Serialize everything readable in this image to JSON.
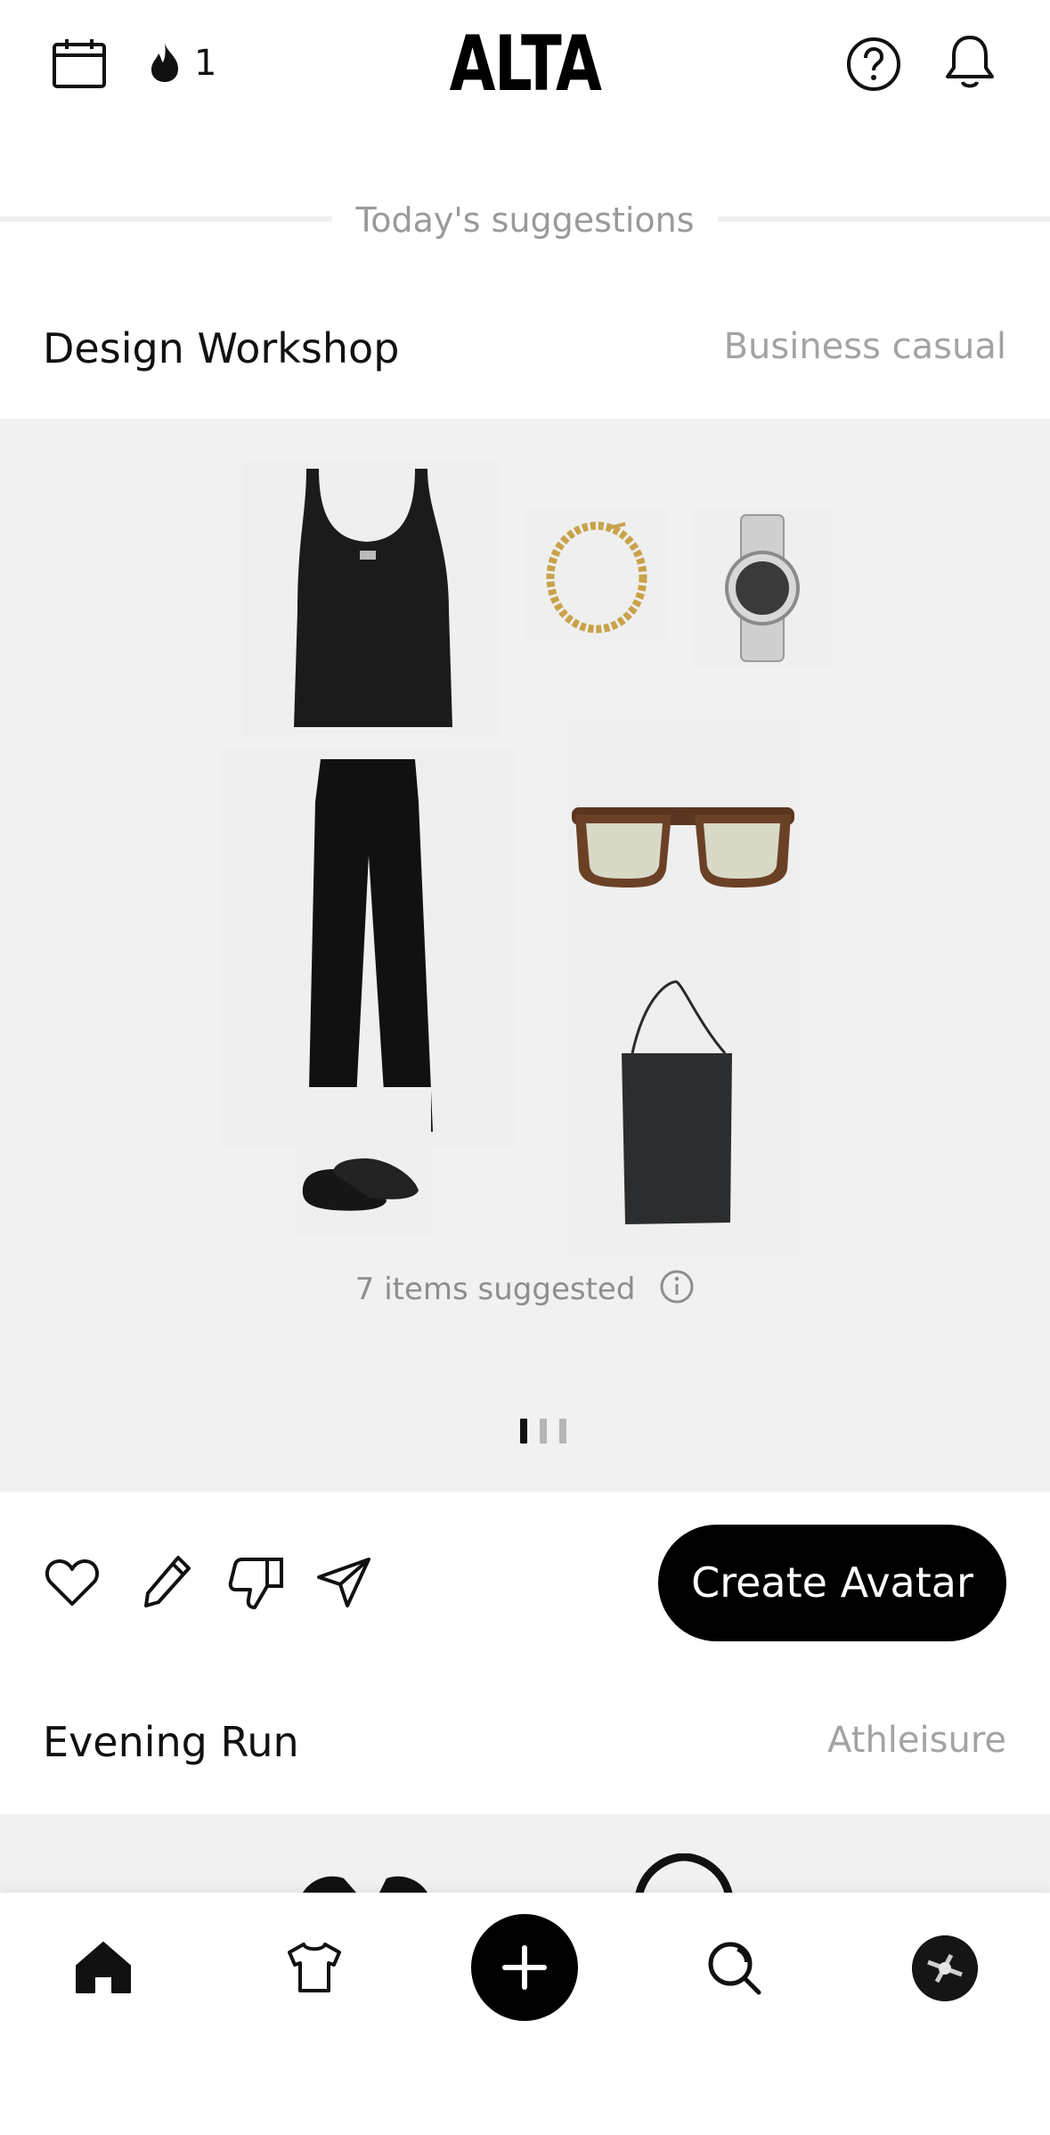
{
  "header": {
    "logo": "ALTA",
    "streak_count": "1",
    "icons": {
      "calendar": "calendar-icon",
      "streak": "flame-icon",
      "help": "help-icon",
      "notifications": "bell-icon"
    }
  },
  "divider_label": "Today's suggestions",
  "suggestions": [
    {
      "title": "Design Workshop",
      "tag": "Business casual",
      "items": [
        {
          "name": "Black knit tank top"
        },
        {
          "name": "Gold chain bracelet"
        },
        {
          "name": "Silver wristwatch"
        },
        {
          "name": "Black wide-leg trousers"
        },
        {
          "name": "Tortoiseshell sunglasses"
        },
        {
          "name": "Black leather tote bag"
        },
        {
          "name": "Black leather loafers"
        }
      ],
      "items_count_text": "7 items suggested",
      "carousel": {
        "total": 3,
        "active": 0
      }
    },
    {
      "title": "Evening Run",
      "tag": "Athleisure"
    }
  ],
  "actions": {
    "like": "heart-icon",
    "edit": "pencil-icon",
    "dislike": "thumbs-down-icon",
    "share": "send-icon",
    "create_avatar_label": "Create Avatar"
  },
  "nav": [
    {
      "id": "home",
      "icon": "home-icon",
      "active": true
    },
    {
      "id": "wardrobe",
      "icon": "shirt-icon"
    },
    {
      "id": "add",
      "icon": "plus-icon"
    },
    {
      "id": "search",
      "icon": "search-icon"
    },
    {
      "id": "profile",
      "icon": "avatar"
    }
  ],
  "colors": {
    "primary": "#000000",
    "panel": "#f1f1f1",
    "muted_text": "#9a9a9a"
  }
}
